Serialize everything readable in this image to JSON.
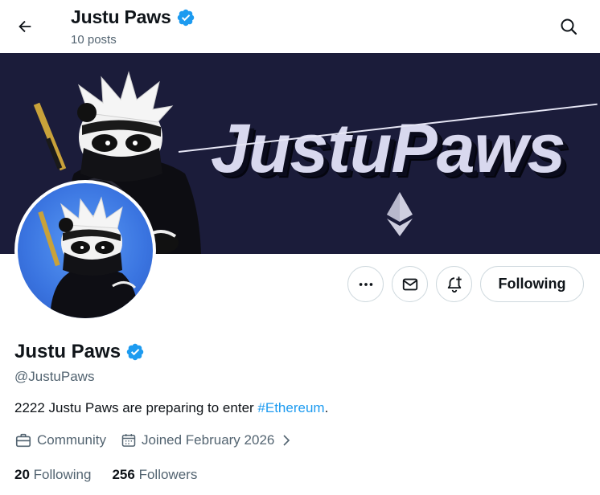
{
  "header": {
    "name": "Justu Paws",
    "posts_count": "10 posts"
  },
  "banner": {
    "wordmark": "JustuPaws"
  },
  "profile": {
    "name": "Justu Paws",
    "handle": "@JustuPaws",
    "bio_text": "2222 Justu Paws are preparing to enter ",
    "bio_hashtag": "#Ethereum",
    "bio_end": ".",
    "category": "Community",
    "joined": "Joined February 2026",
    "following_count": "20",
    "following_label": "Following",
    "followers_count": "256",
    "followers_label": "Followers"
  },
  "actions": {
    "follow_state_label": "Following"
  },
  "icons": {
    "back": "arrow-left-icon",
    "search": "search-icon",
    "verified": "verified-badge-icon",
    "more": "more-icon",
    "message": "mail-icon",
    "notify": "bell-plus-icon",
    "category": "briefcase-icon",
    "joined": "calendar-icon",
    "chevron": "chevron-right-icon"
  },
  "colors": {
    "accent": "#1d9bf0",
    "verified": "#1d9bf0",
    "banner_bg": "#1b1c3a",
    "text_primary": "#0f1419",
    "text_secondary": "#536471"
  }
}
